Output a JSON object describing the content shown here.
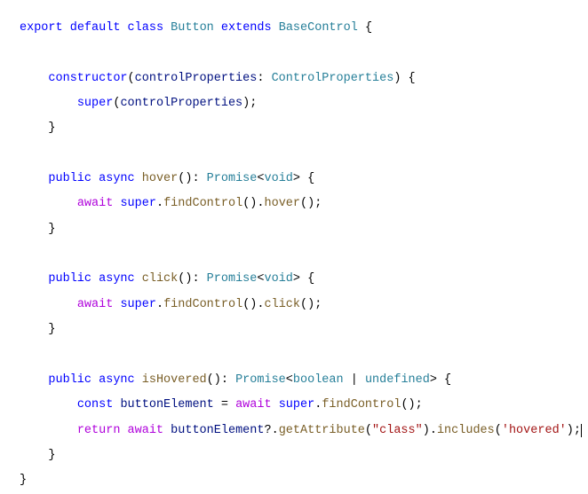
{
  "code": {
    "line1": {
      "export": "export",
      "default": "default",
      "class": "class",
      "className": "Button",
      "extends": "extends",
      "baseClass": "BaseControl",
      "brace": " {"
    },
    "blank": "",
    "ctor": {
      "indent": "    ",
      "keyword": "constructor",
      "open": "(",
      "param": "controlProperties",
      "colon": ": ",
      "paramType": "ControlProperties",
      "close": ") {",
      "bodyIndent": "        ",
      "super": "super",
      "callOpen": "(",
      "arg": "controlProperties",
      "callClose": ");",
      "closeBrace": "    }"
    },
    "hover": {
      "indent": "    ",
      "public": "public",
      "async": "async",
      "name": "hover",
      "sigOpen": "(): ",
      "promise": "Promise",
      "lt": "<",
      "void": "void",
      "gt": "> {",
      "bodyIndent": "        ",
      "await": "await",
      "super": "super",
      "dot1": ".",
      "findControl": "findControl",
      "call1": "().",
      "method": "hover",
      "call2": "();",
      "closeBrace": "    }"
    },
    "click": {
      "indent": "    ",
      "public": "public",
      "async": "async",
      "name": "click",
      "sigOpen": "(): ",
      "promise": "Promise",
      "lt": "<",
      "void": "void",
      "gt": "> {",
      "bodyIndent": "        ",
      "await": "await",
      "super": "super",
      "dot1": ".",
      "findControl": "findControl",
      "call1": "().",
      "method": "click",
      "call2": "();",
      "closeBrace": "    }"
    },
    "isHovered": {
      "indent": "    ",
      "public": "public",
      "async": "async",
      "name": "isHovered",
      "sigOpen": "(): ",
      "promise": "Promise",
      "lt": "<",
      "boolean": "boolean",
      "pipe": " | ",
      "undefined": "undefined",
      "gt": "> {",
      "bodyIndent": "        ",
      "const": "const",
      "varName": "buttonElement",
      "eq": " = ",
      "await": "await",
      "super": "super",
      "dot1": ".",
      "findControl": "findControl",
      "call1": "();",
      "return": "return",
      "await2": "await",
      "var2": "buttonElement",
      "optChain": "?.",
      "getAttr": "getAttribute",
      "paren1": "(",
      "str1": "\"class\"",
      "paren2": ").",
      "includes": "includes",
      "paren3": "(",
      "str2": "'hovered'",
      "paren4": ");",
      "closeBrace": "    }"
    },
    "finalBrace": "}"
  }
}
